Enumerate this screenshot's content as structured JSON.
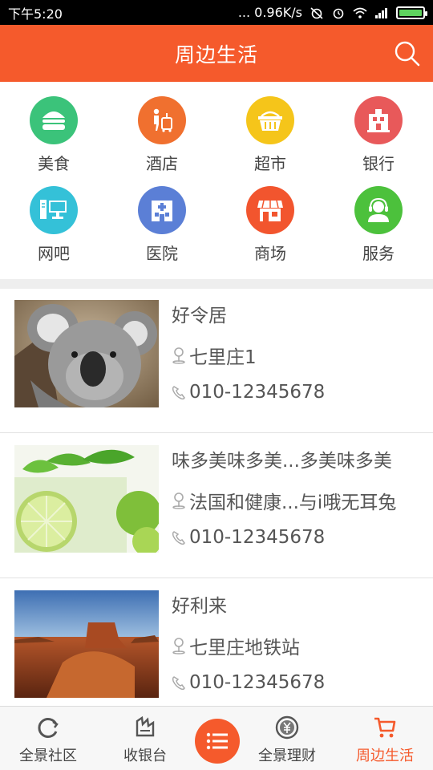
{
  "status_bar": {
    "time": "下午5:20",
    "network_speed": "... 0.96K/s",
    "battery_color": "#5ed35e"
  },
  "header": {
    "title": "周边生活",
    "background": "#f55a2c",
    "search_icon": "search-icon"
  },
  "categories": [
    {
      "label": "美食",
      "icon": "burger-icon",
      "color": "#3bc37a"
    },
    {
      "label": "酒店",
      "icon": "luggage-icon",
      "color": "#f0702f"
    },
    {
      "label": "超市",
      "icon": "basket-icon",
      "color": "#f5c51a"
    },
    {
      "label": "银行",
      "icon": "bank-icon",
      "color": "#e8595a"
    },
    {
      "label": "网吧",
      "icon": "computer-icon",
      "color": "#34c1d8"
    },
    {
      "label": "医院",
      "icon": "hospital-icon",
      "color": "#5b7fd6"
    },
    {
      "label": "商场",
      "icon": "store-icon",
      "color": "#f2552e"
    },
    {
      "label": "服务",
      "icon": "headset-icon",
      "color": "#4cc13c"
    }
  ],
  "places": [
    {
      "name": "好令居",
      "address": "七里庄1",
      "phone": "010-12345678",
      "image": "koala-photo"
    },
    {
      "name": "味多美味多美...多美味多美",
      "address": "法国和健康...与i哦无耳兔",
      "phone": "010-12345678",
      "image": "lime-drink-photo"
    },
    {
      "name": "好利来",
      "address": "七里庄地铁站",
      "phone": "010-12345678",
      "image": "desert-photo"
    }
  ],
  "bottom_nav": {
    "tabs": [
      {
        "label": "全景社区",
        "icon": "refresh-circle-icon"
      },
      {
        "label": "收银台",
        "icon": "cashier-icon"
      },
      {
        "label": "全景理财",
        "icon": "yen-coin-icon"
      },
      {
        "label": "周边生活",
        "icon": "cart-icon",
        "active": true
      }
    ],
    "center_icon": "list-icon",
    "accent": "#f55a2c"
  }
}
